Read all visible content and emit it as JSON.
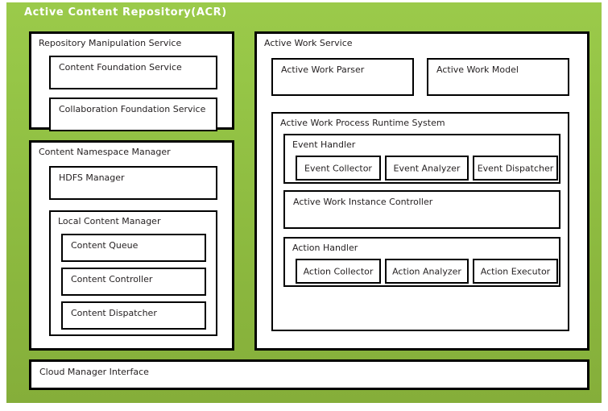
{
  "diagram": {
    "title": "Active  Content  Repository(ACR)",
    "colors": {
      "panel_green_top": "#9bca4a",
      "panel_green_bottom": "#85ae3a",
      "box_border": "#000000",
      "box_fill": "#ffffff",
      "title_text": "#ffffff",
      "label_text": "#231f20"
    }
  },
  "left_column": {
    "repository_manipulation_service": {
      "label": "Repository Manipulation Service",
      "children": {
        "content_foundation_service": "Content Foundation Service",
        "collaboration_foundation_service": "Collaboration Foundation Service"
      }
    },
    "content_namespace_manager": {
      "label": "Content Namespace Manager",
      "hdfs_manager": "HDFS Manager",
      "local_content_manager": {
        "label": "Local Content Manager",
        "children": {
          "content_queue": "Content Queue",
          "content_controller": "Content Controller",
          "content_dispatcher": "Content Dispatcher"
        }
      }
    }
  },
  "right_column": {
    "active_work_service": {
      "label": "Active Work Service",
      "active_work_parser": "Active Work Parser",
      "active_work_model": "Active Work Model",
      "active_work_process_runtime_system": {
        "label": "Active Work Process Runtime System",
        "event_handler": {
          "label": "Event Handler",
          "children": {
            "event_collector": "Event Collector",
            "event_analyzer": "Event Analyzer",
            "event_dispatcher": "Event Dispatcher"
          }
        },
        "active_work_instance_controller": "Active Work Instance Controller",
        "action_handler": {
          "label": "Action Handler",
          "children": {
            "action_collector": "Action Collector",
            "action_analyzer": "Action Analyzer",
            "action_executor": "Action Executor"
          }
        }
      }
    }
  },
  "footer": {
    "cloud_manager_interface": "Cloud Manager Interface"
  }
}
